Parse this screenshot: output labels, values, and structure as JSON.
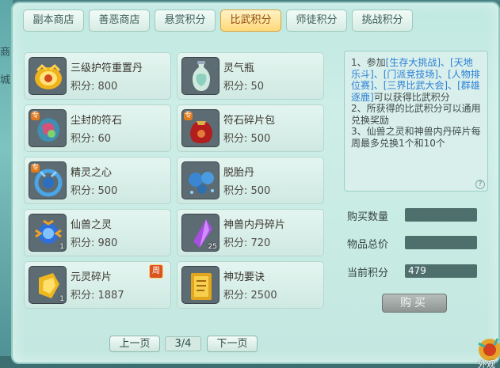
{
  "side_glyphs": [
    "商",
    "城"
  ],
  "tabs": [
    {
      "label": "副本商店",
      "active": false
    },
    {
      "label": "善恶商店",
      "active": false
    },
    {
      "label": "悬赏积分",
      "active": false
    },
    {
      "label": "比武积分",
      "active": true
    },
    {
      "label": "师徒积分",
      "active": false
    },
    {
      "label": "挑战积分",
      "active": false
    }
  ],
  "items": [
    {
      "name": "三级护符重置丹",
      "cost": "积分: 800",
      "icon": "gold-pill-icon"
    },
    {
      "name": "灵气瓶",
      "cost": "积分: 50",
      "icon": "vase-icon"
    },
    {
      "name": "尘封的符石",
      "cost": "积分: 60",
      "icon": "rune-stone-icon",
      "tag": "专"
    },
    {
      "name": "符石碎片包",
      "cost": "积分: 500",
      "icon": "rune-bag-icon",
      "tag": "专"
    },
    {
      "name": "精灵之心",
      "cost": "积分: 500",
      "icon": "spirit-heart-icon",
      "tag": "专"
    },
    {
      "name": "脱胎丹",
      "cost": "积分: 500",
      "icon": "rebirth-pill-icon"
    },
    {
      "name": "仙兽之灵",
      "cost": "积分: 980",
      "icon": "beast-spirit-icon",
      "qty": "1"
    },
    {
      "name": "神兽内丹碎片",
      "cost": "积分: 720",
      "icon": "crystal-shard-icon",
      "qty": "25"
    },
    {
      "name": "元灵碎片",
      "cost": "积分: 1887",
      "icon": "gold-fragment-icon",
      "qty": "1",
      "week_tag": "周"
    },
    {
      "name": "神功要诀",
      "cost": "积分: 2500",
      "icon": "scroll-book-icon"
    }
  ],
  "info": {
    "l1a": "1、参加",
    "l1links": [
      "[生存大挑战]",
      "、[",
      "天地乐斗]",
      "、[门派竞技场]",
      "、[人物排位赛]",
      "、[三界比",
      "武大会]",
      "、[群雄逐鹿]"
    ],
    "l1b": "可以获得比武积分",
    "l2": "2、所获得的比武积分可以通用兑换奖励",
    "l3": "3、仙兽之灵和神兽内丹碎片每周最多兑换1个和10个"
  },
  "form": {
    "qty_label": "购买数量",
    "qty_value": "",
    "total_label": "物品总价",
    "total_value": "",
    "points_label": "当前积分",
    "points_value": "479",
    "buy_label": "购买"
  },
  "pager": {
    "prev": "上一页",
    "page": "3/4",
    "next": "下一页"
  },
  "corner_label": "外观",
  "colors": {
    "active_tab": "#ffd878",
    "link": "#2b7fd6",
    "panel": "#c3e8e0"
  }
}
